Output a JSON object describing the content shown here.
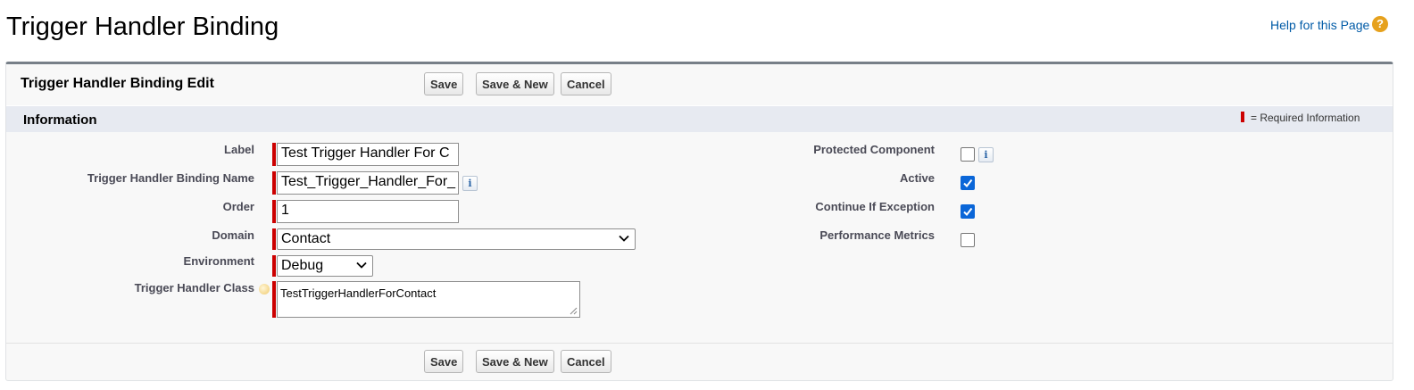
{
  "page": {
    "title": "Trigger Handler Binding",
    "help_link": "Help for this Page",
    "help_icon": "?"
  },
  "panel": {
    "title": "Trigger Handler Binding Edit",
    "buttons": {
      "save": "Save",
      "save_new": "Save & New",
      "cancel": "Cancel"
    }
  },
  "section": {
    "title": "Information",
    "required_legend": "= Required Information"
  },
  "fields": {
    "label": {
      "label": "Label",
      "value": "Test Trigger Handler For C"
    },
    "name": {
      "label": "Trigger Handler Binding Name",
      "value": "Test_Trigger_Handler_For_"
    },
    "order": {
      "label": "Order",
      "value": "1"
    },
    "domain": {
      "label": "Domain",
      "value": "Contact"
    },
    "environment": {
      "label": "Environment",
      "value": "Debug"
    },
    "handler_class": {
      "label": "Trigger Handler Class",
      "value": "TestTriggerHandlerForContact"
    },
    "protected_component": {
      "label": "Protected Component",
      "checked": false
    },
    "active": {
      "label": "Active",
      "checked": true
    },
    "continue_if_exception": {
      "label": "Continue If Exception",
      "checked": true
    },
    "performance_metrics": {
      "label": "Performance Metrics",
      "checked": false
    }
  },
  "info_icon": "i",
  "colors": {
    "required": "#cc0000",
    "link": "#015ba7",
    "checkbox_checked": "#0a66d8",
    "section_bar": "#e7eaf1"
  }
}
